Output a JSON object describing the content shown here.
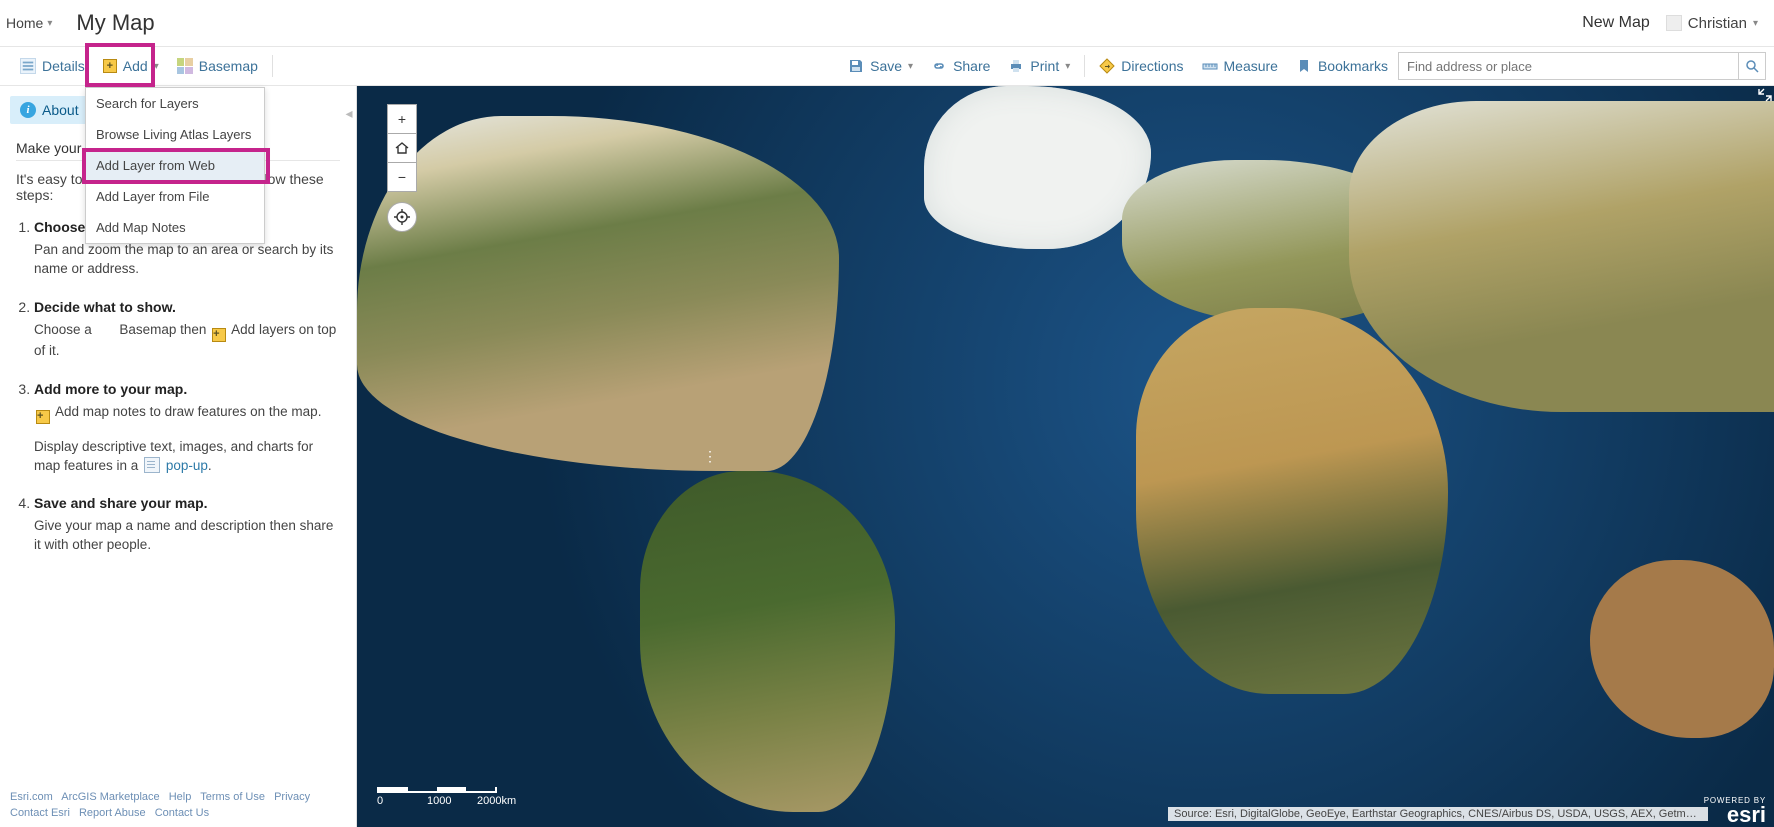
{
  "header": {
    "home": "Home",
    "title": "My Map",
    "new_map": "New Map",
    "user": "Christian"
  },
  "toolbar": {
    "details": "Details",
    "add": "Add",
    "basemap": "Basemap",
    "save": "Save",
    "share": "Share",
    "print": "Print",
    "directions": "Directions",
    "measure": "Measure",
    "bookmarks": "Bookmarks",
    "search_placeholder": "Find address or place"
  },
  "add_menu": {
    "items": [
      "Search for Layers",
      "Browse Living Atlas Layers",
      "Add Layer from Web",
      "Add Layer from File",
      "Add Map Notes"
    ],
    "selected_index": 2
  },
  "sidebar": {
    "tab_about": "About",
    "heading": "Make your own map",
    "intro": "It's easy to make your own map. Just follow these steps:",
    "steps": [
      {
        "title": "Choose an area.",
        "body": "Pan and zoom the map to an area or search by its name or address."
      },
      {
        "title": "Decide what to show.",
        "body_pre": "Choose a ",
        "body_basemap_link": "Basemap",
        "body_mid": " then ",
        "body_addlayers_link": "Add layers",
        "body_post": " on top of it."
      },
      {
        "title": "Add more to your map.",
        "body_pre": "",
        "body_addnotes_link": "Add map notes",
        "body_post": " to draw features on the map.",
        "body2_pre": "Display descriptive text, images, and charts for map features in a ",
        "body2_popup_link": "pop-up",
        "body2_post": "."
      },
      {
        "title": "Save and share your map.",
        "body": "Give your map a name and description then share it with other people."
      }
    ]
  },
  "footer": {
    "links": [
      "Esri.com",
      "ArcGIS Marketplace",
      "Help",
      "Terms of Use",
      "Privacy",
      "Contact Esri",
      "Report Abuse",
      "Contact Us"
    ]
  },
  "map": {
    "attribution": "Source: Esri, DigitalGlobe, GeoEye, Earthstar Geographics, CNES/Airbus DS, USDA, USGS, AEX, Getmapping, Aerogrid, IGN, IGP, swi…",
    "logo_top": "POWERED BY",
    "logo_brand": "esri",
    "scale": {
      "labels": [
        "0",
        "1000",
        "2000km"
      ]
    }
  }
}
